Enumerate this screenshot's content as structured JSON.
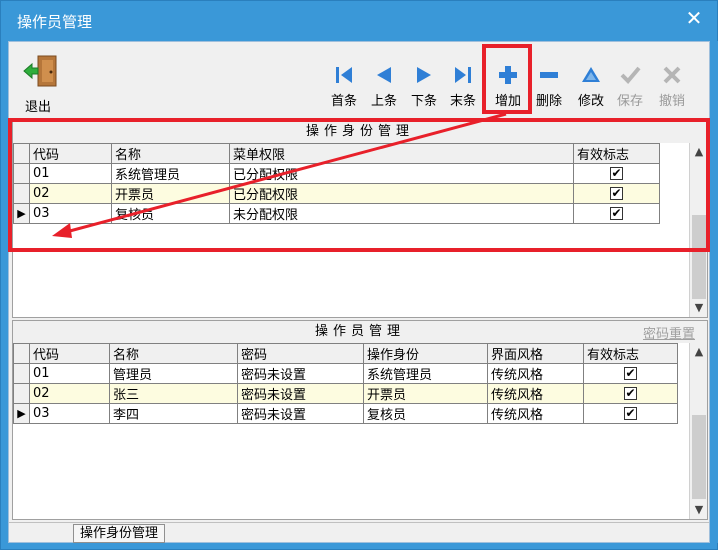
{
  "window": {
    "title": "操作员管理",
    "close_label": "✕"
  },
  "toolbar": {
    "exit_label": "退出",
    "buttons": [
      {
        "label": "首条",
        "icon": "first-icon",
        "enabled": true
      },
      {
        "label": "上条",
        "icon": "prev-icon",
        "enabled": true
      },
      {
        "label": "下条",
        "icon": "next-icon",
        "enabled": true
      },
      {
        "label": "末条",
        "icon": "last-icon",
        "enabled": true
      },
      {
        "label": "增加",
        "icon": "plus-icon",
        "enabled": true
      },
      {
        "label": "删除",
        "icon": "minus-icon",
        "enabled": true
      },
      {
        "label": "修改",
        "icon": "edit-icon",
        "enabled": true
      },
      {
        "label": "保存",
        "icon": "check-icon",
        "enabled": false
      },
      {
        "label": "撤销",
        "icon": "cancel-icon",
        "enabled": false
      }
    ]
  },
  "roles_panel": {
    "title": "操作身份管理",
    "columns": [
      "代码",
      "名称",
      "菜单权限",
      "有效标志"
    ],
    "rows": [
      {
        "code": "01",
        "name": "系统管理员",
        "perm": "已分配权限",
        "valid": "✔",
        "indicator": ""
      },
      {
        "code": "02",
        "name": "开票员",
        "perm": "已分配权限",
        "valid": "✔",
        "indicator": ""
      },
      {
        "code": "03",
        "name": "复核员",
        "perm": "未分配权限",
        "valid": "✔",
        "indicator": "▶"
      }
    ]
  },
  "operators_panel": {
    "title": "操作员管理",
    "reset_link": "密码重置",
    "columns": [
      "代码",
      "名称",
      "密码",
      "操作身份",
      "界面风格",
      "有效标志"
    ],
    "rows": [
      {
        "code": "01",
        "name": "管理员",
        "pwd": "密码未设置",
        "role": "系统管理员",
        "style": "传统风格",
        "valid": "✔",
        "indicator": ""
      },
      {
        "code": "02",
        "name": "张三",
        "pwd": "密码未设置",
        "role": "开票员",
        "style": "传统风格",
        "valid": "✔",
        "indicator": ""
      },
      {
        "code": "03",
        "name": "李四",
        "pwd": "密码未设置",
        "role": "复核员",
        "style": "传统风格",
        "valid": "✔",
        "indicator": "▶"
      }
    ]
  },
  "statusbar": {
    "tab_label": "操作身份管理"
  },
  "colors": {
    "titlebar": "#3a98d8",
    "icon_blue": "#2f7fd6",
    "highlight": "#e8202a",
    "selected_row": "#fdfce0"
  }
}
